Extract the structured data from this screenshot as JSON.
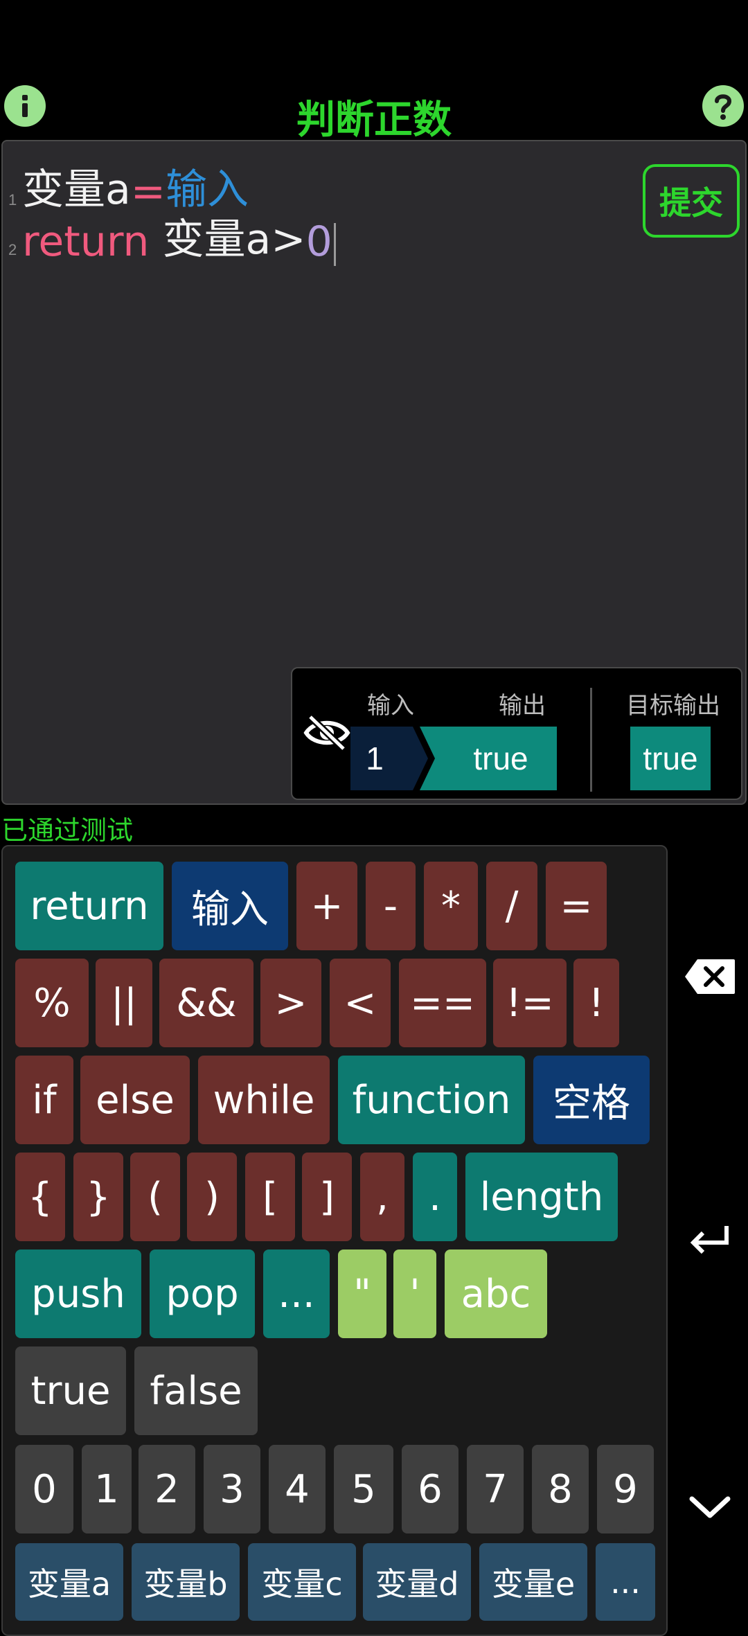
{
  "header": {
    "title": "判断正数",
    "info_icon": "info-icon",
    "help_icon": "help-icon"
  },
  "editor": {
    "lines": [
      {
        "number": "1",
        "tokens": [
          {
            "text": "变量a",
            "color": "#f2f2f2"
          },
          {
            "text": "=",
            "color": "#f05a7e"
          },
          {
            "text": "输入",
            "color": "#2e8fd8"
          }
        ]
      },
      {
        "number": "2",
        "tokens": [
          {
            "text": "return",
            "color": "#f05a7e"
          },
          {
            "text": " 变量a>",
            "color": "#f2f2f2"
          },
          {
            "text": "0",
            "color": "#b39ddb"
          }
        ]
      }
    ],
    "submit_label": "提交"
  },
  "io": {
    "input_label": "输入",
    "output_label": "输出",
    "target_label": "目标输出",
    "input_value": "1",
    "output_value": "true",
    "target_value": "true",
    "toggle_icon": "eye-off-icon"
  },
  "status": "已通过测试",
  "keyboard": {
    "row1": [
      "return",
      "输入",
      "+",
      "-",
      "*",
      "/",
      "="
    ],
    "row2": [
      "%",
      "||",
      "&&",
      ">",
      "<",
      "==",
      "!=",
      "!"
    ],
    "row3": [
      "if",
      "else",
      "while",
      "function",
      "空格"
    ],
    "row4": [
      "{",
      "}",
      "(",
      ")",
      "[",
      "]",
      ",",
      ".",
      "length"
    ],
    "row5": [
      "push",
      "pop",
      "...",
      "\"",
      "'",
      "abc"
    ],
    "row6": [
      "true",
      "false"
    ],
    "row7": [
      "0",
      "1",
      "2",
      "3",
      "4",
      "5",
      "6",
      "7",
      "8",
      "9"
    ],
    "row8": [
      "变量a",
      "变量b",
      "变量c",
      "变量d",
      "变量e",
      "..."
    ]
  },
  "side": {
    "backspace_icon": "backspace-icon",
    "enter_icon": "enter-icon",
    "collapse_icon": "chevron-down-icon"
  },
  "colors": {
    "accent_green": "#2dd62d",
    "teal": "#0d7a70",
    "navy": "#0d3a72",
    "maroon": "#6b2f2c",
    "lime": "#9ccc65"
  }
}
